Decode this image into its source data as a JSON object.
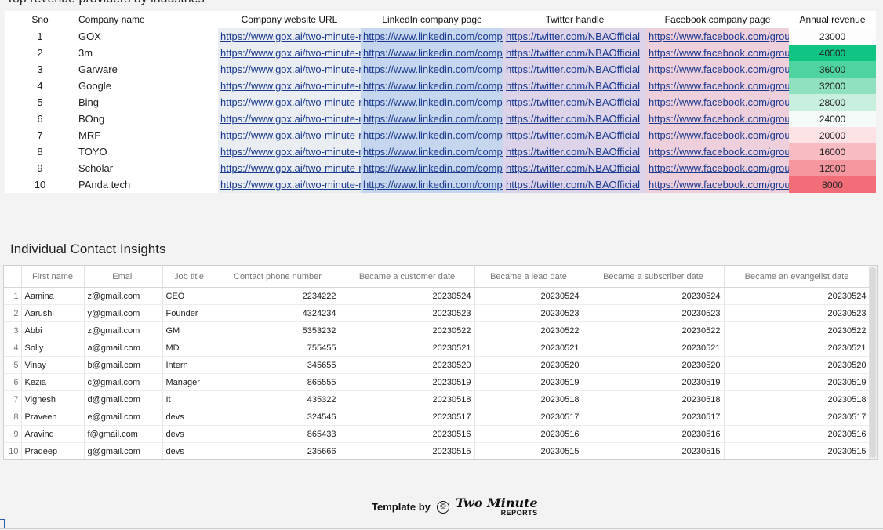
{
  "report": {
    "top_title": "Top revenue providers by industries"
  },
  "company_table": {
    "headers": [
      "Sno",
      "Company name",
      "Company website URL",
      "LinkedIn company page",
      "Twitter handle",
      "Facebook company page",
      "Annual revenue"
    ],
    "rows": [
      {
        "sno": "1",
        "name": "GOX",
        "website": "https://www.gox.ai/two-minute-reports",
        "linkedin": "https://www.linkedin.com/company/",
        "twitter": "https://twitter.com/NBAOfficial",
        "facebook": "https://www.facebook.com/groups/",
        "revenue": "23000",
        "revenue_color": "#fdfdfd"
      },
      {
        "sno": "2",
        "name": "3m",
        "website": "https://www.gox.ai/two-minute-reports",
        "linkedin": "https://www.linkedin.com/company/",
        "twitter": "https://twitter.com/NBAOfficial",
        "facebook": "https://www.facebook.com/groups/",
        "revenue": "40000",
        "revenue_color": "#10c584"
      },
      {
        "sno": "3",
        "name": "Garware",
        "website": "https://www.gox.ai/two-minute-reports",
        "linkedin": "https://www.linkedin.com/company/",
        "twitter": "https://twitter.com/NBAOfficial",
        "facebook": "https://www.facebook.com/groups/",
        "revenue": "36000",
        "revenue_color": "#4fd3a1"
      },
      {
        "sno": "4",
        "name": "Google",
        "website": "https://www.gox.ai/two-minute-reports",
        "linkedin": "https://www.linkedin.com/company/",
        "twitter": "https://twitter.com/NBAOfficial",
        "facebook": "https://www.facebook.com/groups/",
        "revenue": "32000",
        "revenue_color": "#8fe1c0"
      },
      {
        "sno": "5",
        "name": "Bing",
        "website": "https://www.gox.ai/two-minute-reports",
        "linkedin": "https://www.linkedin.com/company/",
        "twitter": "https://twitter.com/NBAOfficial",
        "facebook": "https://www.facebook.com/groups/",
        "revenue": "28000",
        "revenue_color": "#c9efde"
      },
      {
        "sno": "6",
        "name": "BOng",
        "website": "https://www.gox.ai/two-minute-reports",
        "linkedin": "https://www.linkedin.com/company/",
        "twitter": "https://twitter.com/NBAOfficial",
        "facebook": "https://www.facebook.com/groups/",
        "revenue": "24000",
        "revenue_color": "#f4fbf8"
      },
      {
        "sno": "7",
        "name": "MRF",
        "website": "https://www.gox.ai/two-minute-reports",
        "linkedin": "https://www.linkedin.com/company/",
        "twitter": "https://twitter.com/NBAOfficial",
        "facebook": "https://www.facebook.com/groups/",
        "revenue": "20000",
        "revenue_color": "#fde3e6"
      },
      {
        "sno": "8",
        "name": "TOYO",
        "website": "https://www.gox.ai/two-minute-reports",
        "linkedin": "https://www.linkedin.com/company/",
        "twitter": "https://twitter.com/NBAOfficial",
        "facebook": "https://www.facebook.com/groups/",
        "revenue": "16000",
        "revenue_color": "#f9bcc2"
      },
      {
        "sno": "9",
        "name": "Scholar",
        "website": "https://www.gox.ai/two-minute-reports",
        "linkedin": "https://www.linkedin.com/company/",
        "twitter": "https://twitter.com/NBAOfficial",
        "facebook": "https://www.facebook.com/groups/",
        "revenue": "12000",
        "revenue_color": "#f6979f"
      },
      {
        "sno": "10",
        "name": "PAnda tech",
        "website": "https://www.gox.ai/two-minute-reports",
        "linkedin": "https://www.linkedin.com/company/",
        "twitter": "https://twitter.com/NBAOfficial",
        "facebook": "https://www.facebook.com/groups/",
        "revenue": "8000",
        "revenue_color": "#f26d78"
      }
    ]
  },
  "contacts": {
    "title": "Individual Contact Insights",
    "headers": [
      "First name",
      "Email",
      "Job title",
      "Contact phone number",
      "Became a customer date",
      "Became a lead date",
      "Became a subscriber date",
      "Became an evangelist date"
    ],
    "rows": [
      {
        "idx": "1",
        "first": "Aamina",
        "email": "z@gmail.com",
        "job": "CEO",
        "phone": "2234222",
        "customer": "20230524",
        "lead": "20230524",
        "subscriber": "20230524",
        "evangelist": "20230524"
      },
      {
        "idx": "2",
        "first": "Aarushi",
        "email": "y@gmail.com",
        "job": "Founder",
        "phone": "4324234",
        "customer": "20230523",
        "lead": "20230523",
        "subscriber": "20230523",
        "evangelist": "20230523"
      },
      {
        "idx": "3",
        "first": "Abbi",
        "email": "z@gmail.com",
        "job": "GM",
        "phone": "5353232",
        "customer": "20230522",
        "lead": "20230522",
        "subscriber": "20230522",
        "evangelist": "20230522"
      },
      {
        "idx": "4",
        "first": "Solly",
        "email": "a@gmail.com",
        "job": "MD",
        "phone": "755455",
        "customer": "20230521",
        "lead": "20230521",
        "subscriber": "20230521",
        "evangelist": "20230521"
      },
      {
        "idx": "5",
        "first": "Vinay",
        "email": "b@gmail.com",
        "job": "Intern",
        "phone": "345655",
        "customer": "20230520",
        "lead": "20230520",
        "subscriber": "20230520",
        "evangelist": "20230520"
      },
      {
        "idx": "6",
        "first": "Kezia",
        "email": "c@gmail.com",
        "job": "Manager",
        "phone": "865555",
        "customer": "20230519",
        "lead": "20230519",
        "subscriber": "20230519",
        "evangelist": "20230519"
      },
      {
        "idx": "7",
        "first": "Vignesh",
        "email": "d@gmail.com",
        "job": "It",
        "phone": "435322",
        "customer": "20230518",
        "lead": "20230518",
        "subscriber": "20230518",
        "evangelist": "20230518"
      },
      {
        "idx": "8",
        "first": "Praveen",
        "email": "e@gmail.com",
        "job": "devs",
        "phone": "324546",
        "customer": "20230517",
        "lead": "20230517",
        "subscriber": "20230517",
        "evangelist": "20230517"
      },
      {
        "idx": "9",
        "first": "Aravind",
        "email": "f@gmail.com",
        "job": "devs",
        "phone": "865433",
        "customer": "20230516",
        "lead": "20230516",
        "subscriber": "20230516",
        "evangelist": "20230516"
      },
      {
        "idx": "10",
        "first": "Pradeep",
        "email": "g@gmail.com",
        "job": "devs",
        "phone": "235666",
        "customer": "20230515",
        "lead": "20230515",
        "subscriber": "20230515",
        "evangelist": "20230515"
      }
    ]
  },
  "footer": {
    "label": "Template by",
    "copyright_icon": "©",
    "brand_top": "Two Minute",
    "brand_bottom": "REPORTS"
  }
}
